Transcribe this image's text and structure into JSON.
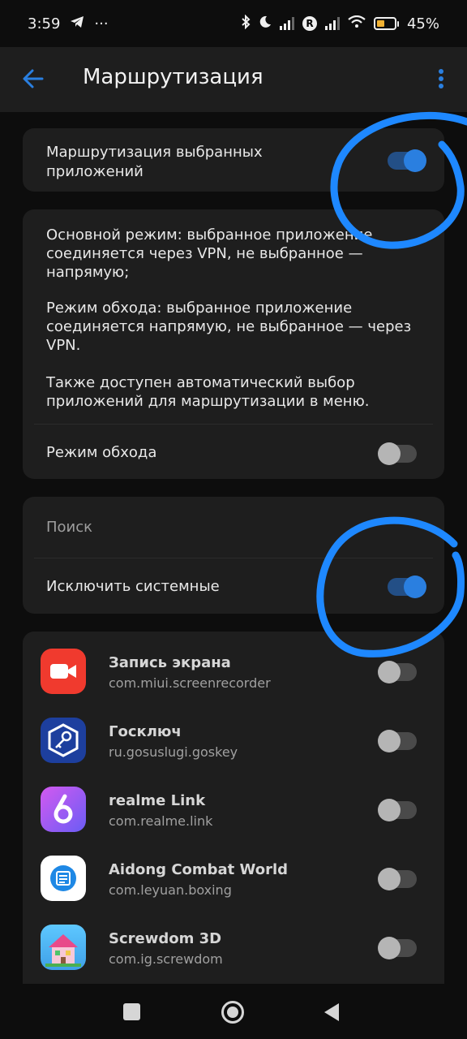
{
  "status_bar": {
    "time": "3:59",
    "dots": "···",
    "battery": "45%",
    "battery_level": 0.45,
    "icons": [
      "telegram-icon",
      "bluetooth-icon",
      "moon-icon",
      "signal-icon",
      "r-icon",
      "signal-icon",
      "wifi-icon",
      "battery-icon"
    ]
  },
  "app_bar": {
    "title": "Маршрутизация",
    "back_icon": "arrow-left-icon",
    "more_icon": "more-vert-icon"
  },
  "routing_card": {
    "label_line1": "Маршрутизация выбранных",
    "label_line2": "приложений",
    "toggle_on": true
  },
  "info_card": {
    "p1_line1": "Основной режим: выбранное приложение",
    "p1_line2": "соединяется через VPN, не выбранное —",
    "p1_line3": "напрямую;",
    "p2_line1": "Режим обхода: выбранное приложение",
    "p2_line2": "соединяется напрямую, не выбранное — через",
    "p2_line3": "VPN.",
    "p3_line1": "Также доступен автоматический выбор",
    "p3_line2": "приложений для маршрутизации в меню.",
    "bypass_label": "Режим обхода",
    "bypass_on": false
  },
  "search_card": {
    "search_placeholder": "Поиск",
    "exclude_label": "Исключить системные",
    "exclude_on": true
  },
  "apps": [
    {
      "name": "Запись экрана",
      "package": "com.miui.screenrecorder",
      "enabled": false,
      "icon": "screen-recorder-icon"
    },
    {
      "name": "Госключ",
      "package": "ru.gosuslugi.goskey",
      "enabled": false,
      "icon": "goskey-icon"
    },
    {
      "name": "realme Link",
      "package": "com.realme.link",
      "enabled": false,
      "icon": "realme-link-icon"
    },
    {
      "name": "Aidong Combat World",
      "package": "com.leyuan.boxing",
      "enabled": false,
      "icon": "aidong-icon"
    },
    {
      "name": "Screwdom 3D",
      "package": "com.ig.screwdom",
      "enabled": false,
      "icon": "screwdom-icon"
    }
  ],
  "nav_bar": {
    "icons": [
      "recents-square-icon",
      "home-circle-icon",
      "back-triangle-icon"
    ]
  },
  "colors": {
    "accent": "#2a7fe0",
    "annotation": "#1e88ff",
    "card": "#1e1e1e",
    "background": "#0d0d0d"
  }
}
